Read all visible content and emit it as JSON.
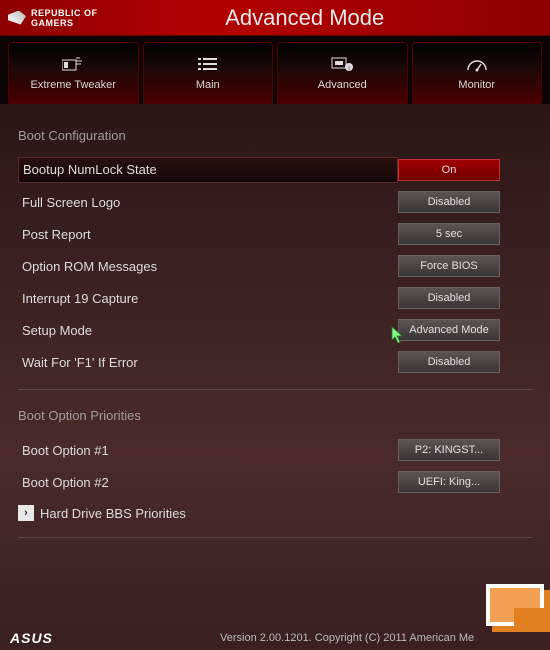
{
  "header": {
    "brand_top": "REPUBLIC OF",
    "brand_bottom": "GAMERS",
    "title": "Advanced Mode"
  },
  "tabs": [
    {
      "label": "Extreme Tweaker"
    },
    {
      "label": "Main"
    },
    {
      "label": "Advanced"
    },
    {
      "label": "Monitor"
    }
  ],
  "sections": {
    "boot_config": {
      "title": "Boot Configuration",
      "rows": [
        {
          "label": "Bootup NumLock State",
          "value": "On",
          "selected": true
        },
        {
          "label": "Full Screen Logo",
          "value": "Disabled"
        },
        {
          "label": "Post Report",
          "value": "5 sec"
        },
        {
          "label": "Option ROM Messages",
          "value": "Force BIOS"
        },
        {
          "label": "Interrupt 19 Capture",
          "value": "Disabled"
        },
        {
          "label": "Setup Mode",
          "value": "Advanced Mode"
        },
        {
          "label": "Wait For 'F1' If Error",
          "value": "Disabled"
        }
      ]
    },
    "boot_priorities": {
      "title": "Boot Option Priorities",
      "rows": [
        {
          "label": "Boot Option #1",
          "value": "P2: KINGST..."
        },
        {
          "label": "Boot Option #2",
          "value": "UEFI: King..."
        }
      ],
      "submenu": "Hard Drive BBS Priorities"
    }
  },
  "footer": {
    "vendor": "ASUS",
    "version": "Version 2.00.1201. Copyright (C) 2011 American Me"
  }
}
